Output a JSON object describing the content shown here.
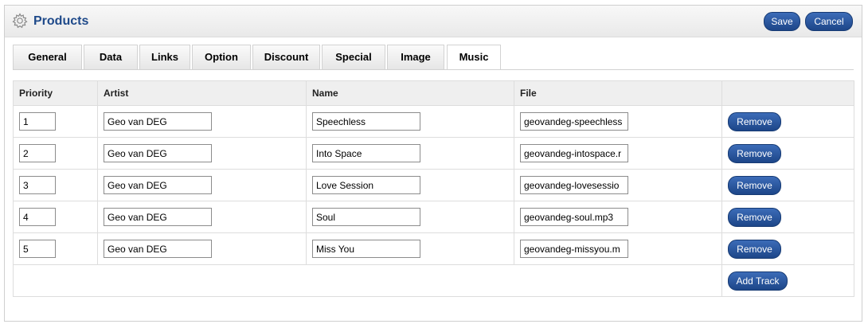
{
  "header": {
    "title": "Products",
    "icon": "gear-icon",
    "save_label": "Save",
    "cancel_label": "Cancel"
  },
  "tabs": [
    {
      "label": "General",
      "active": false
    },
    {
      "label": "Data",
      "active": false
    },
    {
      "label": "Links",
      "active": false
    },
    {
      "label": "Option",
      "active": false
    },
    {
      "label": "Discount",
      "active": false
    },
    {
      "label": "Special",
      "active": false
    },
    {
      "label": "Image",
      "active": false
    },
    {
      "label": "Music",
      "active": true
    }
  ],
  "table": {
    "columns": [
      "Priority",
      "Artist",
      "Name",
      "File",
      ""
    ],
    "rows": [
      {
        "priority": "1",
        "artist": "Geo van DEG",
        "name": "Speechless",
        "file": "geovandeg-speechless"
      },
      {
        "priority": "2",
        "artist": "Geo van DEG",
        "name": "Into Space",
        "file": "geovandeg-intospace.r"
      },
      {
        "priority": "3",
        "artist": "Geo van DEG",
        "name": "Love Session",
        "file": "geovandeg-lovesessio"
      },
      {
        "priority": "4",
        "artist": "Geo van DEG",
        "name": "Soul",
        "file": "geovandeg-soul.mp3"
      },
      {
        "priority": "5",
        "artist": "Geo van DEG",
        "name": "Miss You",
        "file": "geovandeg-missyou.m"
      }
    ],
    "remove_label": "Remove",
    "add_track_label": "Add Track"
  },
  "colors": {
    "title": "#1f4a8a",
    "button_top": "#3c6cb8",
    "button_bottom": "#1d4688",
    "header_bg": "#efefef",
    "border": "#dddddd"
  }
}
